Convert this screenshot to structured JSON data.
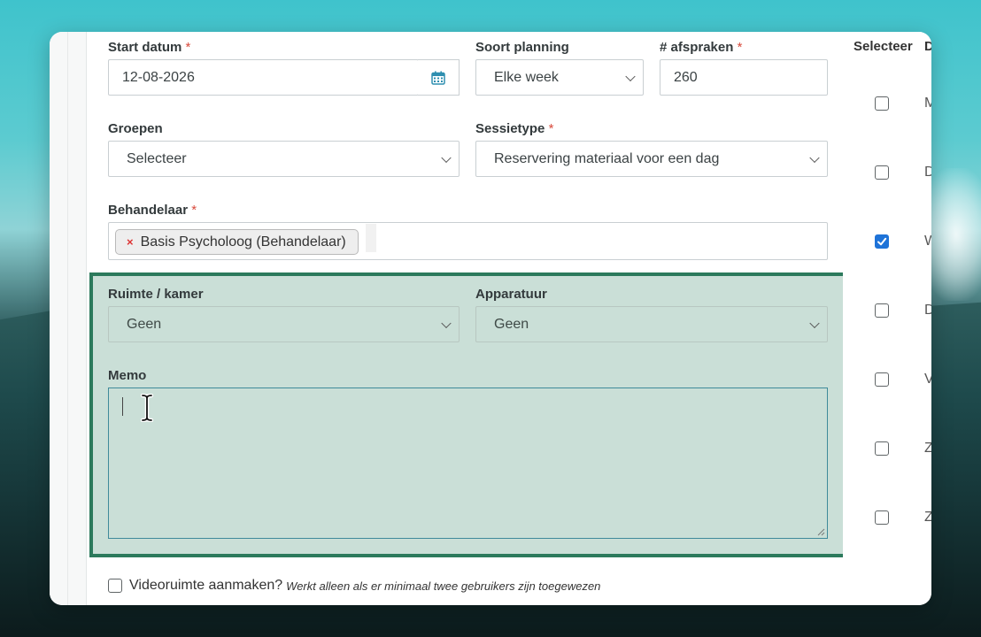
{
  "form": {
    "start_datum": {
      "label": "Start datum",
      "required": "*",
      "value": "12-08-2026"
    },
    "soort_planning": {
      "label": "Soort planning",
      "value": "Elke week"
    },
    "afspraken": {
      "label": "# afspraken",
      "required": "*",
      "value": "260"
    },
    "groepen": {
      "label": "Groepen",
      "value": "Selecteer"
    },
    "sessietype": {
      "label": "Sessietype",
      "required": "*",
      "value": "Reservering materiaal voor een dag"
    },
    "behandelaar": {
      "label": "Behandelaar",
      "required": "*",
      "tag": "Basis Psycholoog (Behandelaar)",
      "tag_remove": "×"
    },
    "ruimte": {
      "label": "Ruimte / kamer",
      "value": "Geen"
    },
    "apparatuur": {
      "label": "Apparatuur",
      "value": "Geen"
    },
    "memo": {
      "label": "Memo",
      "value": ""
    },
    "video": {
      "label": "Videoruimte aanmaken?",
      "hint": "Werkt alleen als er minimaal twee gebruikers zijn toegewezen",
      "checked": false
    }
  },
  "right_panel": {
    "header_select": "Selecteer",
    "header_day": "D",
    "rows": [
      {
        "letter": "M",
        "checked": false
      },
      {
        "letter": "D",
        "checked": false
      },
      {
        "letter": "W",
        "checked": true
      },
      {
        "letter": "D",
        "checked": false
      },
      {
        "letter": "V",
        "checked": false
      },
      {
        "letter": "Z",
        "checked": false
      },
      {
        "letter": "Z",
        "checked": false
      }
    ]
  },
  "colors": {
    "highlight_border": "#2c7a5c",
    "highlight_fill": "#cadfd7",
    "required": "#d84a3c",
    "checkbox_checked": "#1e73d8",
    "calendar_icon": "#2f8fb0"
  },
  "icons": [
    "calendar-icon",
    "chevron-down-icon",
    "remove-tag-icon",
    "text-cursor-icon",
    "resize-handle-icon",
    "checkmark-icon"
  ]
}
